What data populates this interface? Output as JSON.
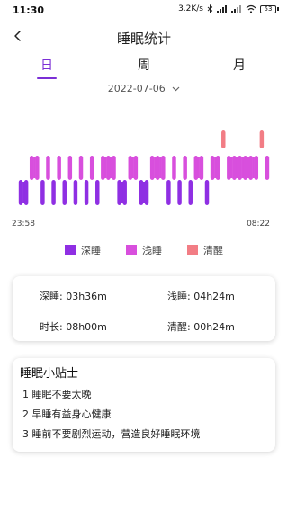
{
  "status_bar": {
    "time": "11:30",
    "net_speed": "3.2K/s",
    "battery": "53"
  },
  "header": {
    "title": "睡眠统计",
    "back_icon": "chevron-left-icon"
  },
  "tabs": [
    {
      "label": "日",
      "active": true
    },
    {
      "label": "周",
      "active": false
    },
    {
      "label": "月",
      "active": false
    }
  ],
  "date_selector": {
    "value": "2022-07-06",
    "icon": "chevron-down-icon"
  },
  "colors": {
    "deep": "#8f2fe3",
    "light": "#d84fdd",
    "awake": "#f27d85",
    "accent": "#7b2fd6"
  },
  "chart_data": {
    "type": "hypnogram",
    "start": "23:58",
    "end": "08:22",
    "stages": [
      "deep",
      "deep",
      "light",
      "light",
      "deep",
      "light",
      "deep",
      "light",
      "deep",
      "light",
      "deep",
      "light",
      "deep",
      "light",
      "deep",
      "light",
      "light",
      "light",
      "deep",
      "deep",
      "light",
      "light",
      "deep",
      "deep",
      "light",
      "light",
      "light",
      "deep",
      "light",
      "deep",
      "light",
      "deep",
      "light",
      "light",
      "deep",
      "light",
      "light",
      "awake",
      "light",
      "light",
      "light",
      "light",
      "light",
      "light",
      "awake",
      "light"
    ],
    "legend": [
      {
        "label": "深睡",
        "stage": "deep"
      },
      {
        "label": "浅睡",
        "stage": "light"
      },
      {
        "label": "清醒",
        "stage": "awake"
      }
    ]
  },
  "summary": {
    "deep_sleep": "深睡:  03h36m",
    "light_sleep": "浅睡:  04h24m",
    "duration": "时长:  08h00m",
    "awake": "清醒:  00h24m"
  },
  "tips": {
    "title": "睡眠小贴士",
    "items": [
      "1 睡眠不要太晚",
      "2 早睡有益身心健康",
      "3 睡前不要剧烈运动，营造良好睡眠环境"
    ]
  }
}
